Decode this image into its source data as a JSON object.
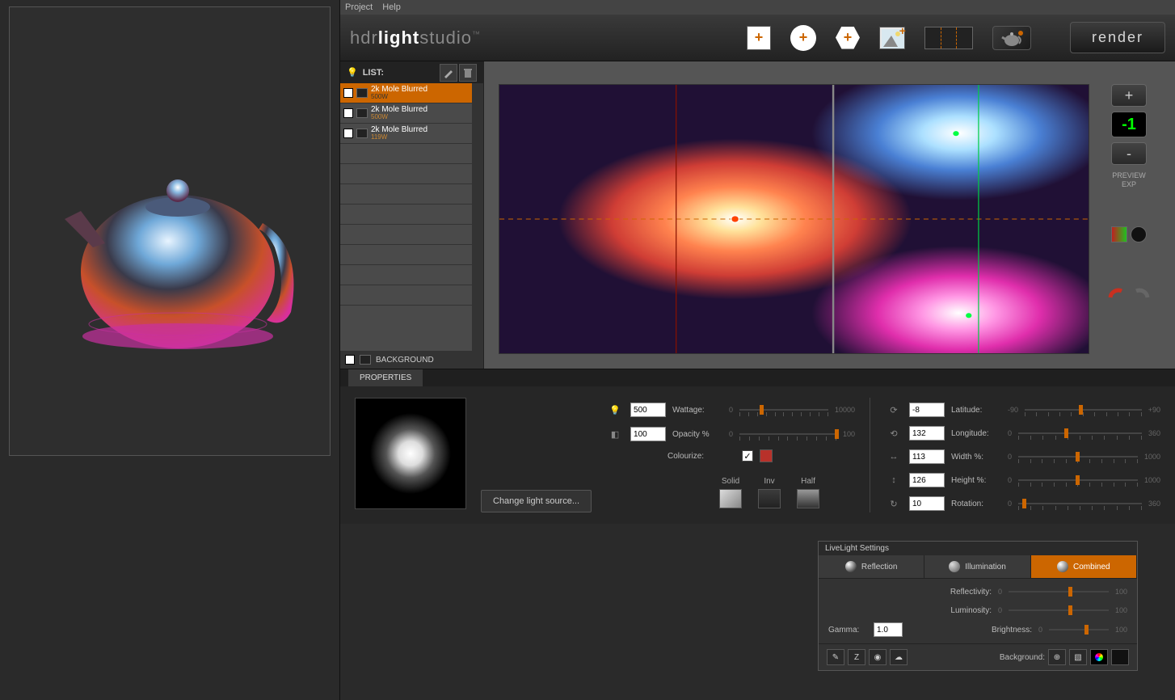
{
  "menu": {
    "project": "Project",
    "help": "Help"
  },
  "logo": {
    "p1": "hdr",
    "p2": "light",
    "p3": "studio"
  },
  "render_btn": "render",
  "list": {
    "title": "LIST:",
    "items": [
      {
        "name": "2k Mole Blurred",
        "sub": "500W"
      },
      {
        "name": "2k Mole Blurred",
        "sub": "500W"
      },
      {
        "name": "2k Mole Blurred",
        "sub": "119W"
      }
    ],
    "background": "BACKGROUND"
  },
  "exposure": {
    "value": "-1",
    "plus": "+",
    "minus": "-",
    "label1": "PREVIEW",
    "label2": "EXP"
  },
  "properties": {
    "tab": "PROPERTIES",
    "change": "Change light source...",
    "wattage": {
      "label": "Wattage:",
      "value": "500",
      "min": "0",
      "max": "10000",
      "pos": 23
    },
    "opacity": {
      "label": "Opacity %",
      "value": "100",
      "min": "0",
      "max": "100",
      "pos": 98
    },
    "colourize": {
      "label": "Colourize:",
      "checked": true,
      "color": "#b8312a"
    },
    "modes": {
      "solid": "Solid",
      "inv": "Inv",
      "half": "Half"
    },
    "latitude": {
      "label": "Latitude:",
      "value": "-8",
      "min": "-90",
      "max": "+90",
      "pos": 46
    },
    "longitude": {
      "label": "Longitude:",
      "value": "132",
      "min": "0",
      "max": "360",
      "pos": 37
    },
    "width": {
      "label": "Width %:",
      "value": "113",
      "min": "0",
      "max": "1000",
      "pos": 48
    },
    "height": {
      "label": "Height %:",
      "value": "126",
      "min": "0",
      "max": "1000",
      "pos": 48
    },
    "rotation": {
      "label": "Rotation:",
      "value": "10",
      "min": "0",
      "max": "360",
      "pos": 3
    }
  },
  "livelight": {
    "title": "LiveLight Settings",
    "tabs": {
      "reflection": "Reflection",
      "illumination": "Illumination",
      "combined": "Combined"
    },
    "reflectivity": {
      "label": "Reflectivity:",
      "min": "0",
      "max": "100",
      "pos": 60
    },
    "luminosity": {
      "label": "Luminosity:",
      "min": "0",
      "max": "100",
      "pos": 60
    },
    "brightness": {
      "label": "Brightness:",
      "min": "0",
      "max": "100",
      "pos": 60
    },
    "gamma": {
      "label": "Gamma:",
      "value": "1.0"
    },
    "background": "Background:"
  }
}
